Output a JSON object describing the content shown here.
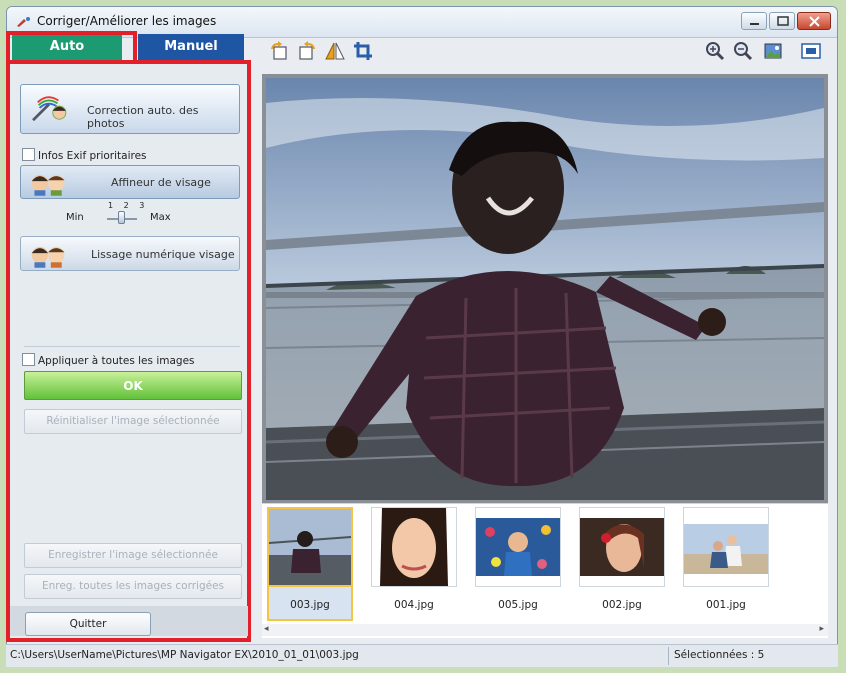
{
  "window": {
    "title": "Corriger/Améliorer les images"
  },
  "tabs": {
    "auto": "Auto",
    "manual": "Manuel"
  },
  "auto_panel": {
    "auto_correct_button": "Correction auto. des photos",
    "exif_checkbox": "Infos Exif prioritaires",
    "face_sharpener_button": "Affineur de visage",
    "slider": {
      "min_label": "Min",
      "max_label": "Max",
      "ticks": "1 2 3",
      "value": 2
    },
    "face_smoothing_button": "Lissage numérique visage",
    "apply_all_checkbox": "Appliquer à toutes les images",
    "ok_button": "OK",
    "reset_button": "Réinitialiser l'image sélectionnée",
    "save_selected_button": "Enregistrer l'image sélectionnée",
    "save_all_button": "Enreg. toutes les images corrigées",
    "quit_button": "Quitter"
  },
  "toolbar": {
    "left_tools": [
      "rotate-left-icon",
      "rotate-right-icon",
      "flip-icon",
      "crop-icon"
    ],
    "right_tools": [
      "zoom-in-icon",
      "zoom-out-icon",
      "view-image-icon",
      "full-screen-icon"
    ]
  },
  "thumbnails": [
    {
      "label": "003.jpg",
      "selected": true
    },
    {
      "label": "004.jpg",
      "selected": false
    },
    {
      "label": "005.jpg",
      "selected": false
    },
    {
      "label": "002.jpg",
      "selected": false
    },
    {
      "label": "001.jpg",
      "selected": false
    }
  ],
  "status": {
    "path": "C:\\Users\\UserName\\Pictures\\MP Navigator EX\\2010_01_01\\003.jpg",
    "selected": "Sélectionnées : 5"
  },
  "colors": {
    "auto_tab": "#1c9a72",
    "manual_tab": "#1f56a3",
    "highlight": "#e2202a",
    "ok": "#62c23a"
  }
}
